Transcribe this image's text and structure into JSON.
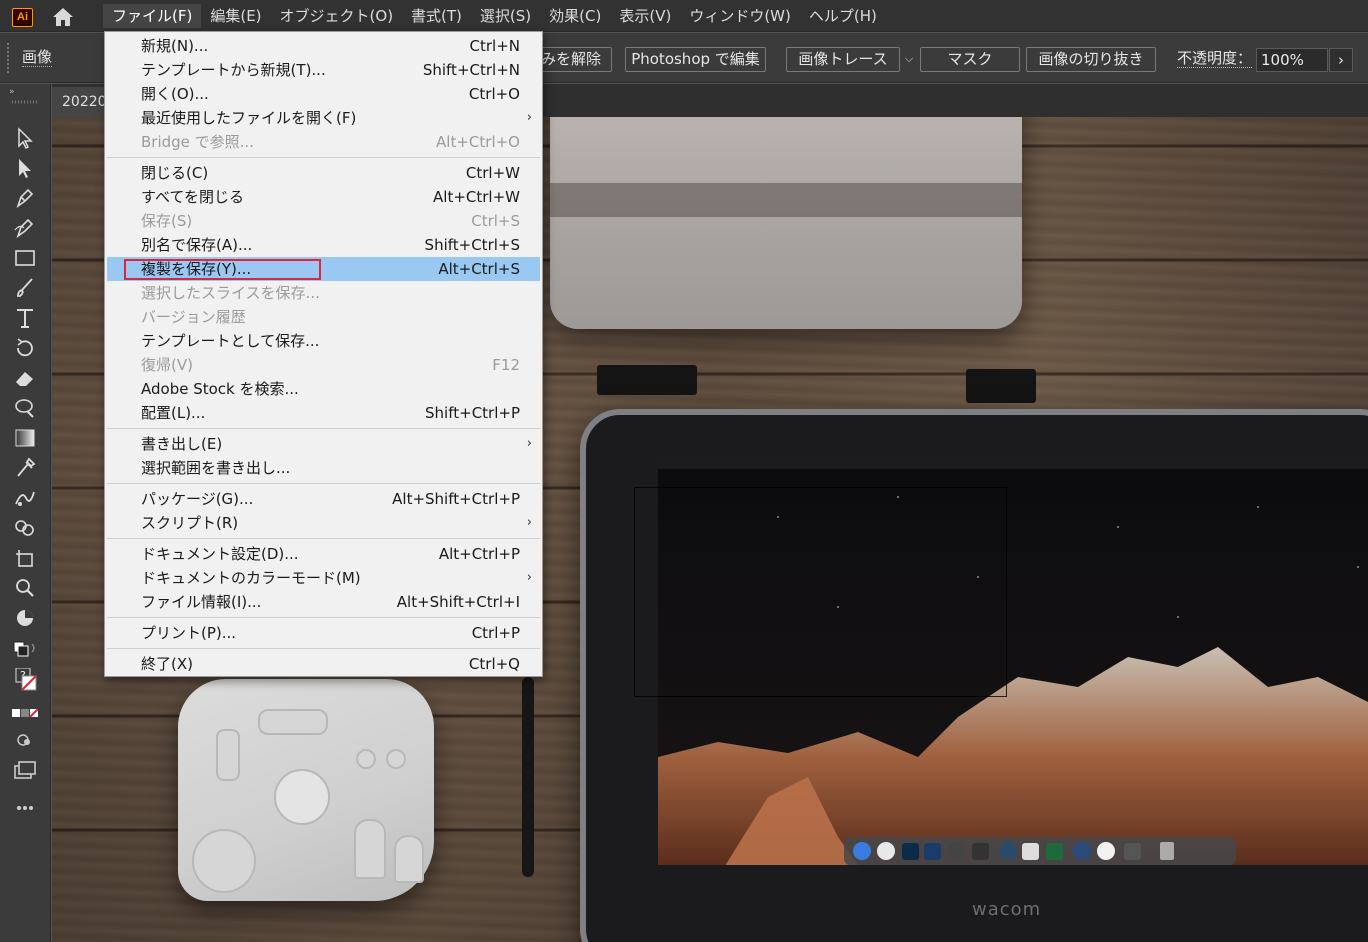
{
  "app": {
    "logo": "Ai"
  },
  "menubar": {
    "items": [
      {
        "label": "ファイル(F)",
        "active": true
      },
      {
        "label": "編集(E)"
      },
      {
        "label": "オブジェクト(O)"
      },
      {
        "label": "書式(T)"
      },
      {
        "label": "選択(S)"
      },
      {
        "label": "効果(C)"
      },
      {
        "label": "表示(V)"
      },
      {
        "label": "ウィンドウ(W)"
      },
      {
        "label": "ヘルプ(H)"
      }
    ]
  },
  "controlbar": {
    "context_label": "画像",
    "release_label": "みを解除",
    "photoshop_label": "Photoshop で編集",
    "trace_label": "画像トレース",
    "mask_label": "マスク",
    "crop_label": "画像の切り抜き",
    "opacity_label": "不透明度：",
    "opacity_value": "100%"
  },
  "document": {
    "tab_label": "20220"
  },
  "file_menu": {
    "items": [
      {
        "label": "新規(N)...",
        "shortcut": "Ctrl+N"
      },
      {
        "label": "テンプレートから新規(T)...",
        "shortcut": "Shift+Ctrl+N"
      },
      {
        "label": "開く(O)...",
        "shortcut": "Ctrl+O"
      },
      {
        "label": "最近使用したファイルを開く(F)",
        "submenu": true
      },
      {
        "label": "Bridge で参照...",
        "shortcut": "Alt+Ctrl+O",
        "disabled": true
      },
      {
        "separator": true
      },
      {
        "label": "閉じる(C)",
        "shortcut": "Ctrl+W"
      },
      {
        "label": "すべてを閉じる",
        "shortcut": "Alt+Ctrl+W"
      },
      {
        "label": "保存(S)",
        "shortcut": "Ctrl+S",
        "disabled": true
      },
      {
        "label": "別名で保存(A)...",
        "shortcut": "Shift+Ctrl+S"
      },
      {
        "label": "複製を保存(Y)...",
        "shortcut": "Alt+Ctrl+S",
        "highlighted": true
      },
      {
        "label": "選択したスライスを保存...",
        "disabled": true
      },
      {
        "label": "バージョン履歴",
        "disabled": true
      },
      {
        "label": "テンプレートとして保存..."
      },
      {
        "label": "復帰(V)",
        "shortcut": "F12",
        "disabled": true
      },
      {
        "label": "Adobe Stock を検索..."
      },
      {
        "label": "配置(L)...",
        "shortcut": "Shift+Ctrl+P"
      },
      {
        "separator": true
      },
      {
        "label": "書き出し(E)",
        "submenu": true
      },
      {
        "label": "選択範囲を書き出し..."
      },
      {
        "separator": true
      },
      {
        "label": "パッケージ(G)...",
        "shortcut": "Alt+Shift+Ctrl+P"
      },
      {
        "label": "スクリプト(R)",
        "submenu": true
      },
      {
        "separator": true
      },
      {
        "label": "ドキュメント設定(D)...",
        "shortcut": "Alt+Ctrl+P"
      },
      {
        "label": "ドキュメントのカラーモード(M)",
        "submenu": true
      },
      {
        "label": "ファイル情報(I)...",
        "shortcut": "Alt+Shift+Ctrl+I"
      },
      {
        "separator": true
      },
      {
        "label": "プリント(P)...",
        "shortcut": "Ctrl+P"
      },
      {
        "separator": true
      },
      {
        "label": "終了(X)",
        "shortcut": "Ctrl+Q"
      }
    ]
  },
  "photo": {
    "brand_text": "wacom"
  },
  "tools": [
    "selection-tool",
    "direct-selection-tool",
    "pen-tool",
    "curvature-tool",
    "rectangle-tool",
    "paintbrush-tool",
    "type-tool",
    "rotate-tool",
    "eraser-tool",
    "lasso-zoom-tool",
    "gradient-tool",
    "eyedropper-tool",
    "puppet-warp-tool",
    "shape-builder-tool",
    "artboard-tool",
    "zoom-tool",
    "pie-chart-tool"
  ],
  "colors": {
    "menubar_bg": "#323232",
    "menu_highlight": "#99c9f2",
    "callout_red": "#e0253a",
    "ai_orange": "#ff9a00"
  }
}
